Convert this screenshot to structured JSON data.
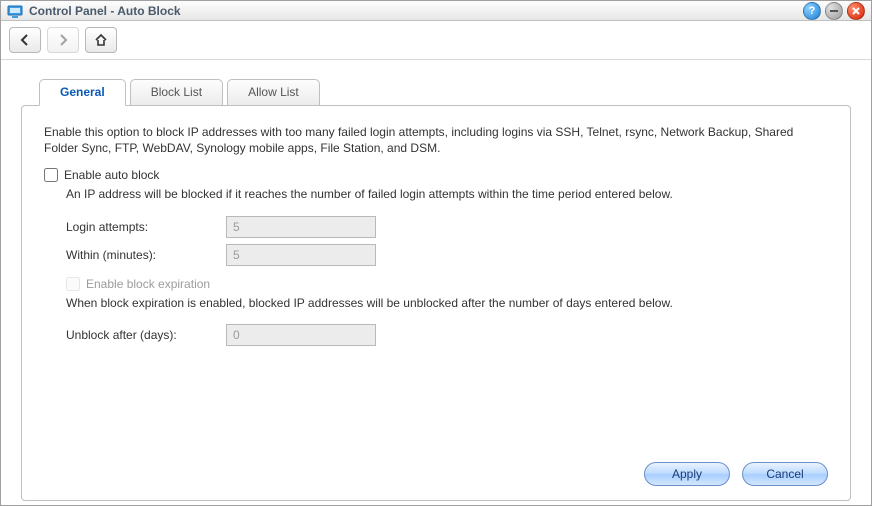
{
  "window": {
    "title": "Control Panel - Auto Block"
  },
  "tabs": [
    {
      "label": "General",
      "active": true
    },
    {
      "label": "Block List",
      "active": false
    },
    {
      "label": "Allow List",
      "active": false
    }
  ],
  "general": {
    "intro": "Enable this option to block IP addresses with too many failed login attempts, including logins via SSH, Telnet, rsync, Network Backup, Shared Folder Sync, FTP, WebDAV, Synology mobile apps, File Station, and DSM.",
    "enable_label": "Enable auto block",
    "enable_checked": false,
    "blocked_desc": "An IP address will be blocked if it reaches the number of failed login attempts within the time period entered below.",
    "login_attempts_label": "Login attempts:",
    "login_attempts_value": "5",
    "within_label": "Within (minutes):",
    "within_value": "5",
    "expire_label": "Enable block expiration",
    "expire_checked": false,
    "expire_desc": "When block expiration is enabled, blocked IP addresses will be unblocked after the number of days entered below.",
    "unblock_label": "Unblock after (days):",
    "unblock_value": "0"
  },
  "buttons": {
    "apply": "Apply",
    "cancel": "Cancel"
  }
}
